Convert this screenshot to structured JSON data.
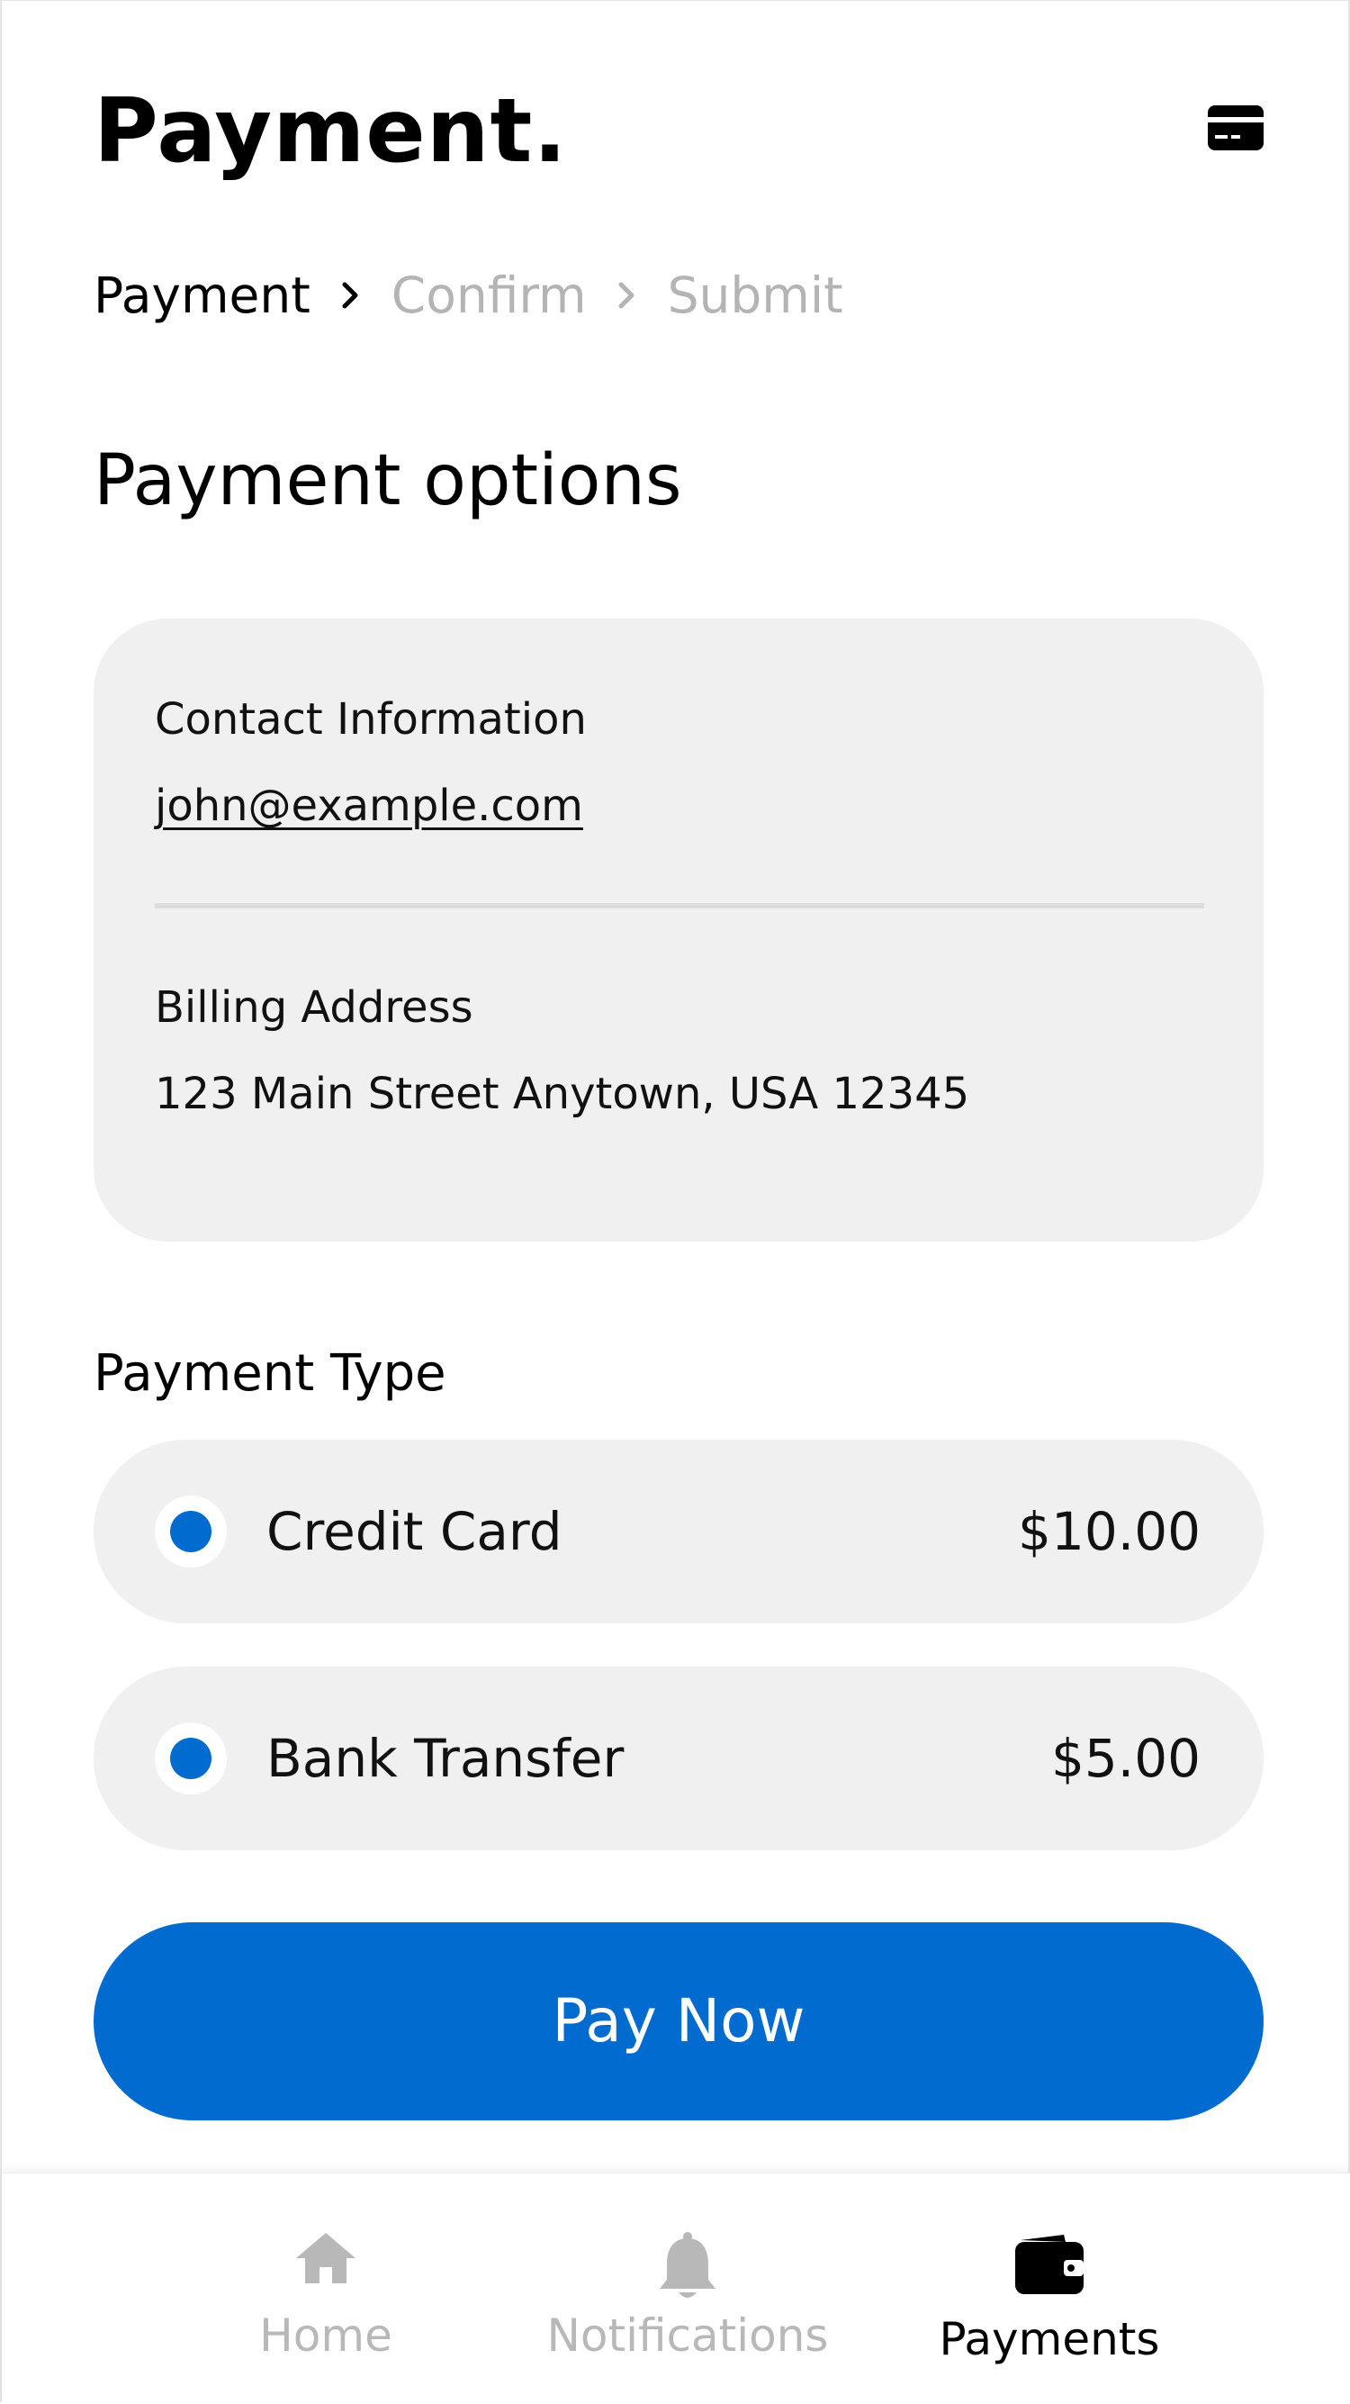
{
  "header": {
    "title": "Payment."
  },
  "breadcrumb": {
    "steps": [
      {
        "label": "Payment",
        "state": "active"
      },
      {
        "label": "Confirm",
        "state": "inactive"
      },
      {
        "label": "Submit",
        "state": "inactive"
      }
    ]
  },
  "section": {
    "title": "Payment options"
  },
  "info_card": {
    "contact_label": "Contact Information",
    "contact_email": "john@example.com",
    "billing_label": "Billing Address",
    "billing_address": "123 Main Street Anytown, USA 12345"
  },
  "payment_type": {
    "label": "Payment Type",
    "options": [
      {
        "name": "Credit Card",
        "price": "$10.00"
      },
      {
        "name": "Bank Transfer",
        "price": "$5.00"
      }
    ]
  },
  "pay_button": {
    "label": "Pay Now"
  },
  "bottom_nav": {
    "items": [
      {
        "label": "Home",
        "icon": "home-icon",
        "state": "inactive"
      },
      {
        "label": "Notifications",
        "icon": "bell-icon",
        "state": "inactive"
      },
      {
        "label": "Payments",
        "icon": "wallet-icon",
        "state": "active"
      }
    ]
  },
  "colors": {
    "accent": "#016bd0",
    "card_bg": "#f0f0f0",
    "inactive_text": "#b4b4b4",
    "text": "#000000"
  }
}
